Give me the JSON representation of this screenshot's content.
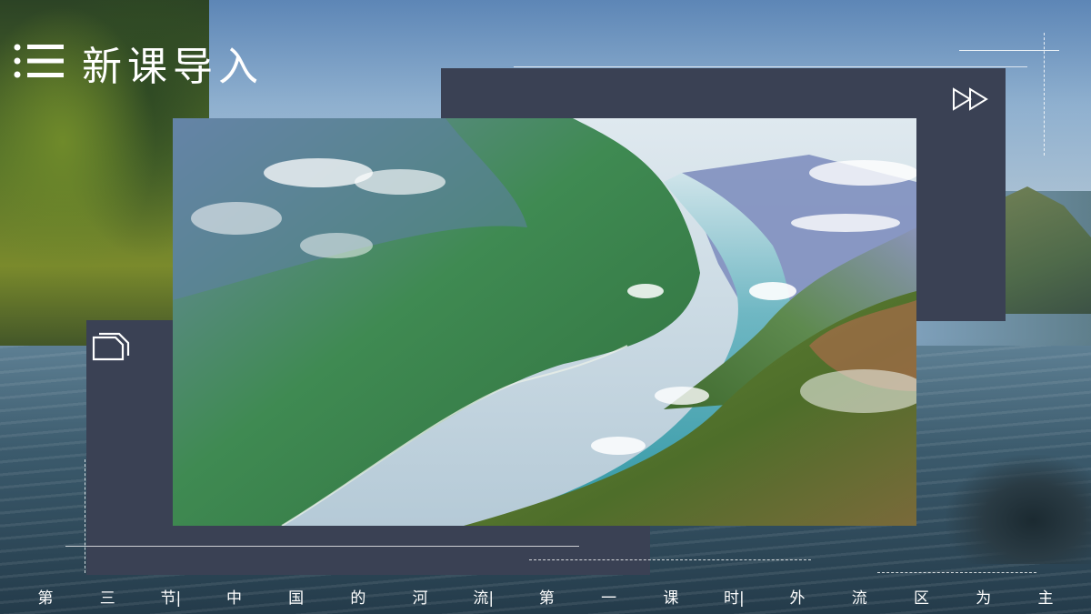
{
  "slide": {
    "title": "新课导入",
    "title_icon": "list-icon",
    "top_panel_icon": "fast-forward-icon",
    "bottom_panel_icon": "documents-icon"
  },
  "photo": {
    "subject": "river-gorge-aerial"
  },
  "footer": {
    "chars": [
      "第",
      "三",
      "节|",
      "中",
      "国",
      "的",
      "河",
      "流|",
      "第",
      "一",
      "课",
      "时|",
      "外",
      "流",
      "区",
      "为",
      "主"
    ]
  },
  "colors": {
    "panel": "#3a4154",
    "text": "#ffffff",
    "river": "#3a9fae"
  }
}
